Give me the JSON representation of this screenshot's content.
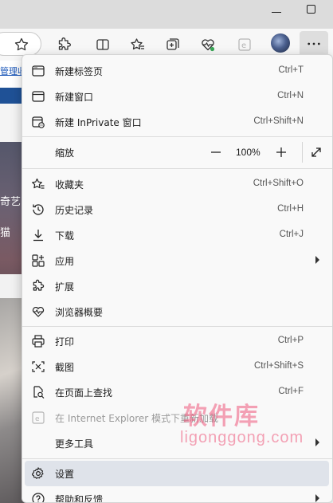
{
  "page": {
    "link_text": "管理收",
    "text_1": "奇艺",
    "text_2": "猫"
  },
  "menu": {
    "items": [
      {
        "label": "新建标签页",
        "shortcut": "Ctrl+T"
      },
      {
        "label": "新建窗口",
        "shortcut": "Ctrl+N"
      },
      {
        "label": "新建 InPrivate 窗口",
        "shortcut": "Ctrl+Shift+N"
      },
      {
        "label": "收藏夹",
        "shortcut": "Ctrl+Shift+O"
      },
      {
        "label": "历史记录",
        "shortcut": "Ctrl+H"
      },
      {
        "label": "下载",
        "shortcut": "Ctrl+J"
      },
      {
        "label": "应用",
        "shortcut": ""
      },
      {
        "label": "扩展",
        "shortcut": ""
      },
      {
        "label": "浏览器概要",
        "shortcut": ""
      },
      {
        "label": "打印",
        "shortcut": "Ctrl+P"
      },
      {
        "label": "截图",
        "shortcut": "Ctrl+Shift+S"
      },
      {
        "label": "在页面上查找",
        "shortcut": "Ctrl+F"
      },
      {
        "label": "在 Internet Explorer 模式下重新加载",
        "shortcut": ""
      },
      {
        "label": "更多工具",
        "shortcut": ""
      },
      {
        "label": "设置",
        "shortcut": ""
      },
      {
        "label": "帮助和反馈",
        "shortcut": ""
      }
    ],
    "zoom": {
      "label": "缩放",
      "value": "100%"
    }
  },
  "watermark": {
    "line1": "软件库",
    "line2": "ligonggong.com"
  },
  "colors": {
    "menu_bg": "#f9f9f9",
    "highlight": "#dfe3ea",
    "watermark": "#ee587c",
    "page_band": "#1f5196"
  }
}
